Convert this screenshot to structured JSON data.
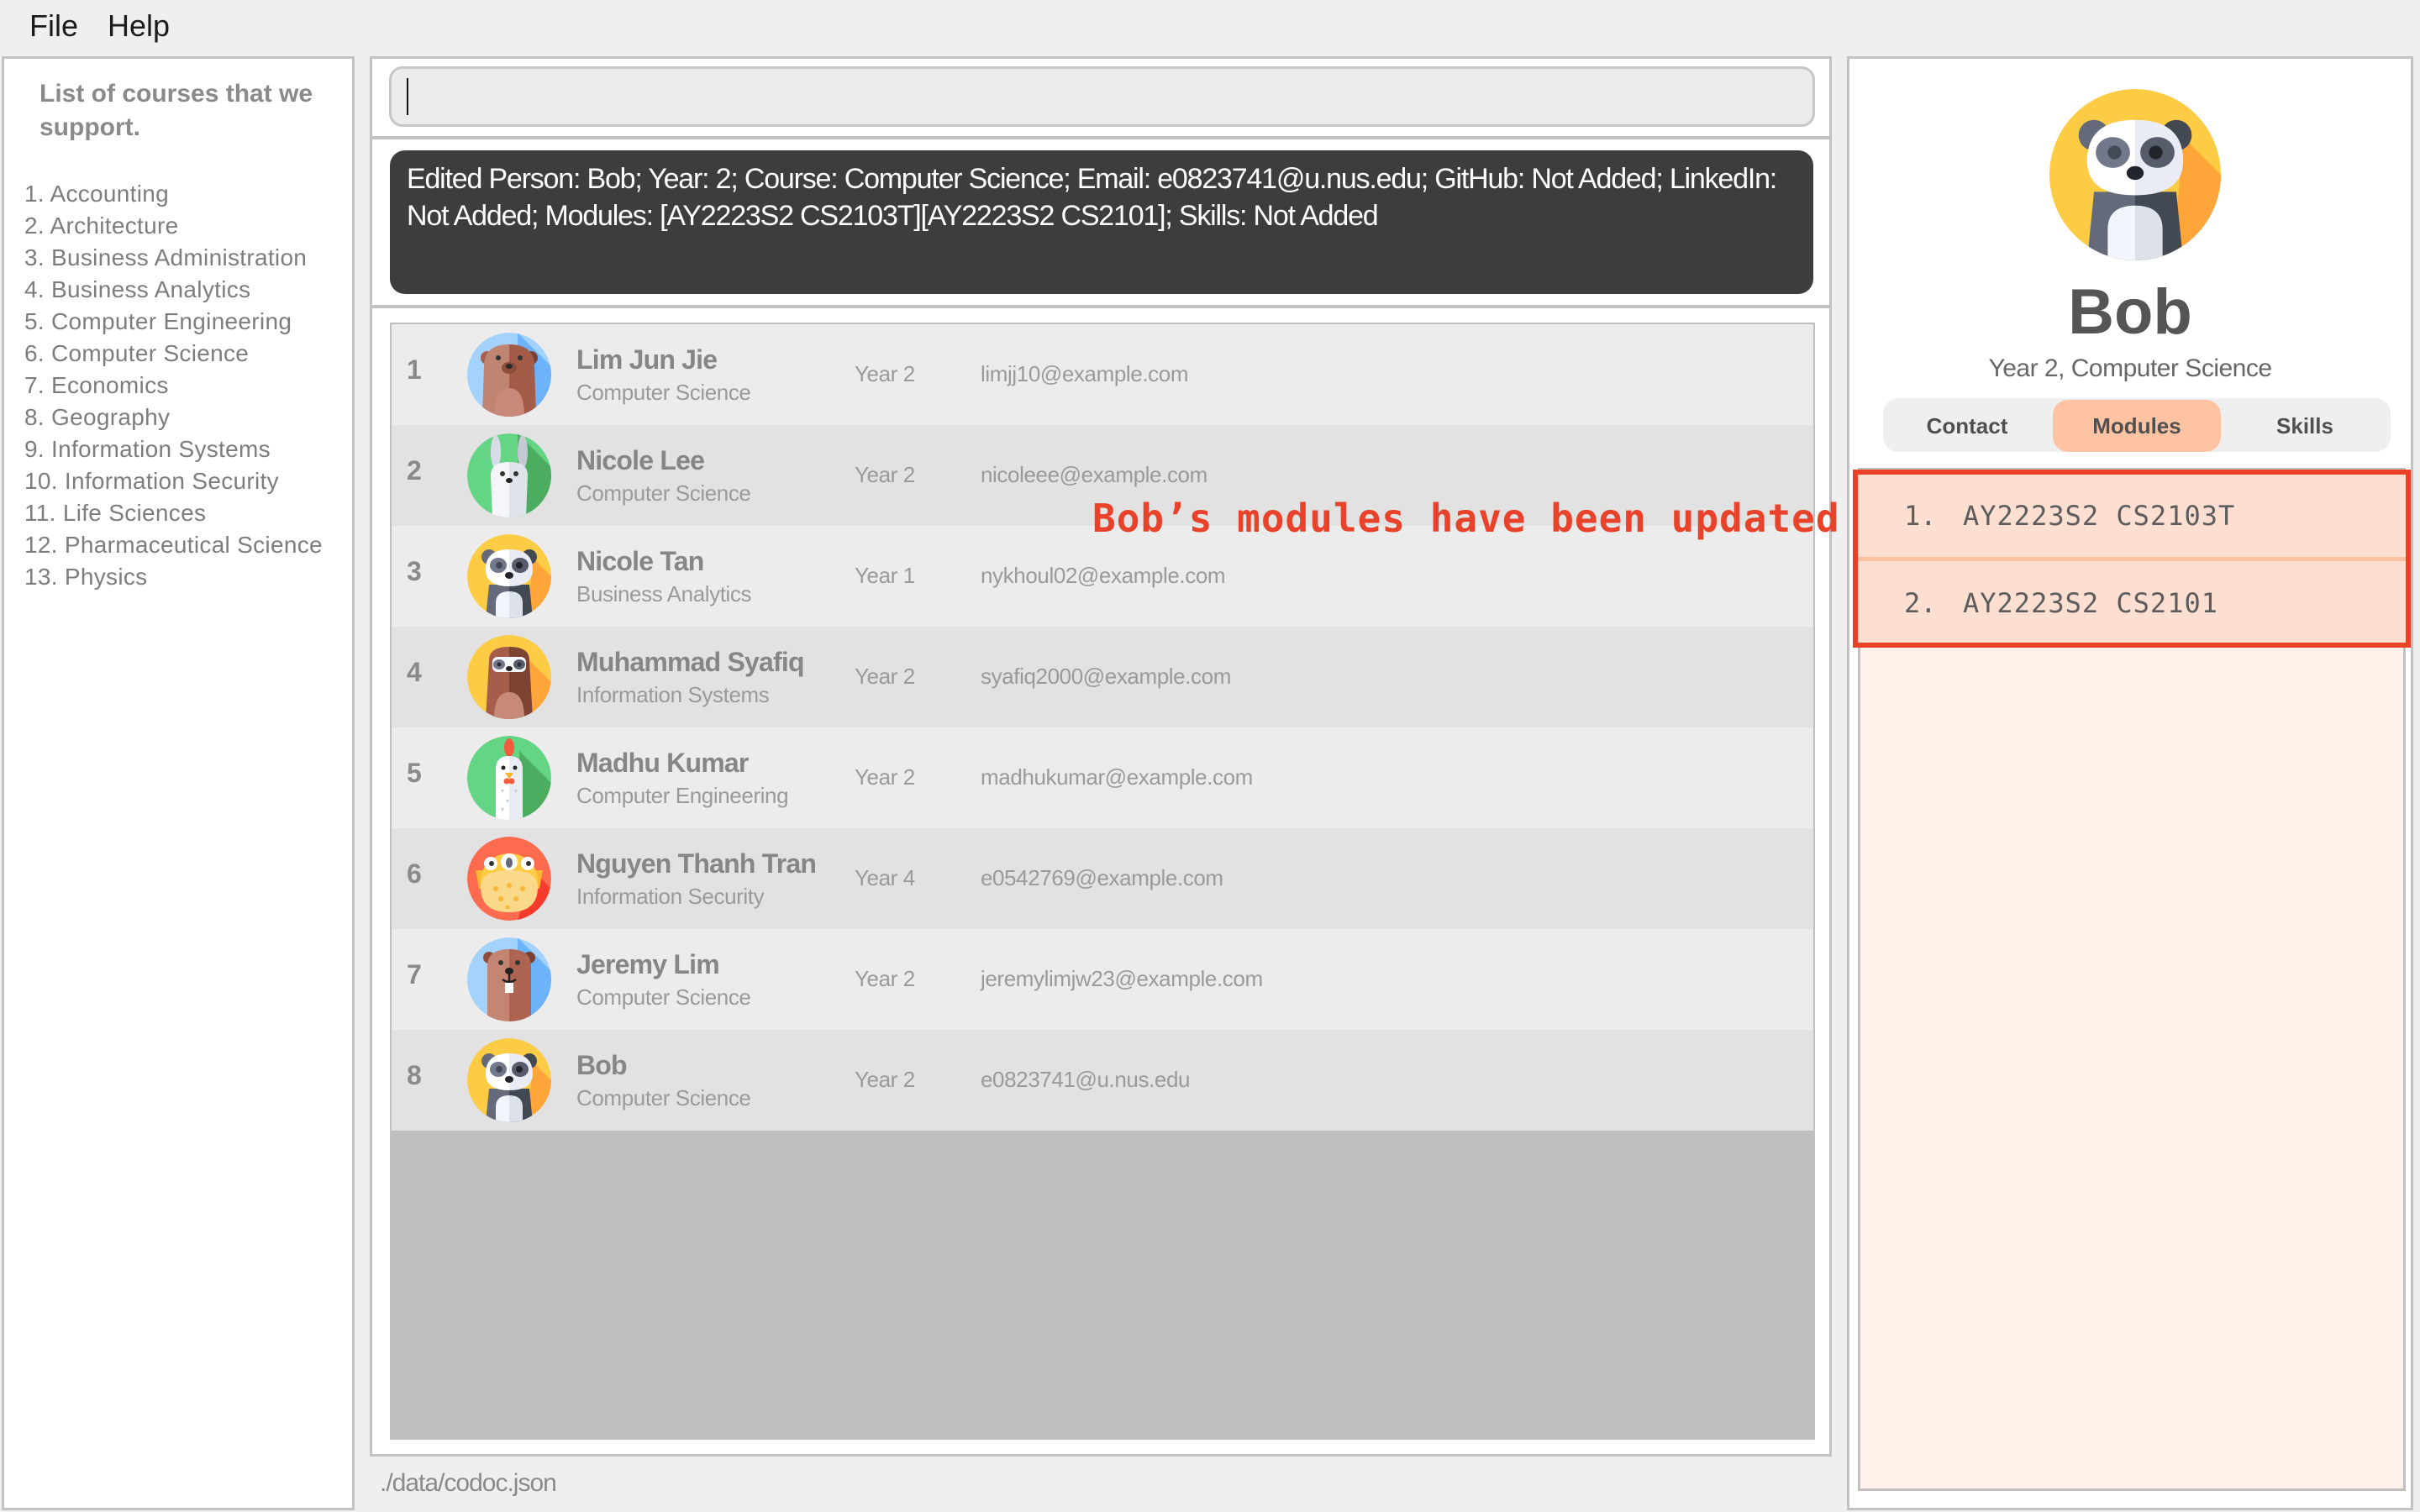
{
  "menu": {
    "file": "File",
    "help": "Help"
  },
  "courses_panel": {
    "title": "List of courses that we support.",
    "courses": [
      "1. Accounting",
      "2. Architecture",
      "3. Business Administration",
      "4. Business Analytics",
      "5. Computer Engineering",
      "6. Computer Science",
      "7. Economics",
      "8. Geography",
      "9. Information Systems",
      "10. Information Security",
      "11. Life Sciences",
      "12. Pharmaceutical Science",
      "13. Physics"
    ]
  },
  "command_box": {
    "value": "",
    "placeholder": ""
  },
  "result_display": {
    "text": "Edited Person: Bob; Year: 2; Course: Computer Science; Email: e0823741@u.nus.edu; GitHub: Not Added; LinkedIn: Not Added; Modules: [AY2223S2 CS2103T][AY2223S2 CS2101]; Skills: Not Added"
  },
  "persons": [
    {
      "index": "1",
      "name": "Lim Jun Jie",
      "course": "Computer Science",
      "year": "Year 2",
      "email": "limjj10@example.com",
      "avatar": "bear-icon"
    },
    {
      "index": "2",
      "name": "Nicole Lee",
      "course": "Computer Science",
      "year": "Year 2",
      "email": "nicoleee@example.com",
      "avatar": "rabbit-icon"
    },
    {
      "index": "3",
      "name": "Nicole Tan",
      "course": "Business Analytics",
      "year": "Year 1",
      "email": "nykhoul02@example.com",
      "avatar": "panda-icon"
    },
    {
      "index": "4",
      "name": "Muhammad Syafiq",
      "course": "Information Systems",
      "year": "Year 2",
      "email": "syafiq2000@example.com",
      "avatar": "sloth-icon"
    },
    {
      "index": "5",
      "name": "Madhu Kumar",
      "course": "Computer Engineering",
      "year": "Year 2",
      "email": "madhukumar@example.com",
      "avatar": "chicken-icon"
    },
    {
      "index": "6",
      "name": "Nguyen Thanh Tran",
      "course": "Information Security",
      "year": "Year 4",
      "email": "e0542769@example.com",
      "avatar": "pufferfish-icon"
    },
    {
      "index": "7",
      "name": "Jeremy Lim",
      "course": "Computer Science",
      "year": "Year 2",
      "email": "jeremylimjw23@example.com",
      "avatar": "beaver-icon"
    },
    {
      "index": "8",
      "name": "Bob",
      "course": "Computer Science",
      "year": "Year 2",
      "email": "e0823741@u.nus.edu",
      "avatar": "panda-icon"
    }
  ],
  "status_bar": {
    "path": "./data/codoc.json"
  },
  "annotation": {
    "text": "Bob’s modules have been updated",
    "color": "#e8432a"
  },
  "profile": {
    "name": "Bob",
    "subtitle": "Year 2, Computer Science",
    "avatar": "panda-icon",
    "tabs": [
      {
        "label": "Contact",
        "active": false
      },
      {
        "label": "Modules",
        "active": true
      },
      {
        "label": "Skills",
        "active": false
      }
    ],
    "modules": [
      {
        "num": "1.",
        "code": "AY2223S2 CS2103T"
      },
      {
        "num": "2.",
        "code": "AY2223S2 CS2101"
      }
    ]
  },
  "colors": {
    "accent_tab": "#fdc3a2",
    "highlight_border": "#ea4126",
    "result_bg": "#3d3d3d"
  }
}
